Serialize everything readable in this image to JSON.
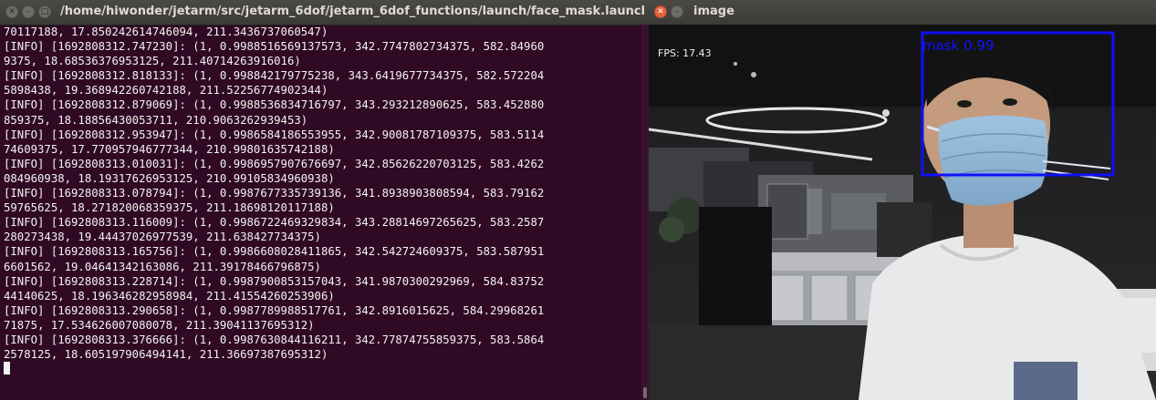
{
  "terminal": {
    "title": "/home/hiwonder/jetarm/src/jetarm_6dof/jetarm_6dof_functions/launch/face_mask.launch http://loca",
    "lines": [
      "70117188, 17.850242614746094, 211.3436737060547)",
      "[INFO] [1692808312.747230]: (1, 0.9988516569137573, 342.7747802734375, 582.84960",
      "9375, 18.68536376953125, 211.40714263916016)",
      "[INFO] [1692808312.818133]: (1, 0.998842179775238, 343.6419677734375, 582.572204",
      "5898438, 19.368942260742188, 211.52256774902344)",
      "[INFO] [1692808312.879069]: (1, 0.9988536834716797, 343.293212890625, 583.452880",
      "859375, 18.18856430053711, 210.9063262939453)",
      "[INFO] [1692808312.953947]: (1, 0.9986584186553955, 342.90081787109375, 583.5114",
      "74609375, 17.770957946777344, 210.99801635742188)",
      "[INFO] [1692808313.010031]: (1, 0.9986957907676697, 342.85626220703125, 583.4262",
      "084960938, 18.19317626953125, 210.99105834960938)",
      "[INFO] [1692808313.078794]: (1, 0.9987677335739136, 341.8938903808594, 583.79162",
      "59765625, 18.271820068359375, 211.18698120117188)",
      "[INFO] [1692808313.116009]: (1, 0.9986722469329834, 343.28814697265625, 583.2587",
      "280273438, 19.44437026977539, 211.638427734375)",
      "[INFO] [1692808313.165756]: (1, 0.9986608028411865, 342.542724609375, 583.587951",
      "6601562, 19.04641342163086, 211.39178466796875)",
      "[INFO] [1692808313.228714]: (1, 0.9987900853157043, 341.9870300292969, 584.83752",
      "44140625, 18.196346282958984, 211.41554260253906)",
      "[INFO] [1692808313.290658]: (1, 0.9987789988517761, 342.8916015625, 584.29968261",
      "71875, 17.534626007080078, 211.39041137695312)",
      "[INFO] [1692808313.376666]: (1, 0.9987630844116211, 342.77874755859375, 583.5864",
      "2578125, 18.605197906494141, 211.36697387695312)"
    ]
  },
  "image_window": {
    "title": "image",
    "fps_text": "FPS: 17.43",
    "detection_label": "mask 0.99",
    "box_color": "#1010ff"
  },
  "colors": {
    "terminal_bg": "#300a24",
    "terminal_fg": "#f2f2f2",
    "close_button": "#e9643c"
  }
}
